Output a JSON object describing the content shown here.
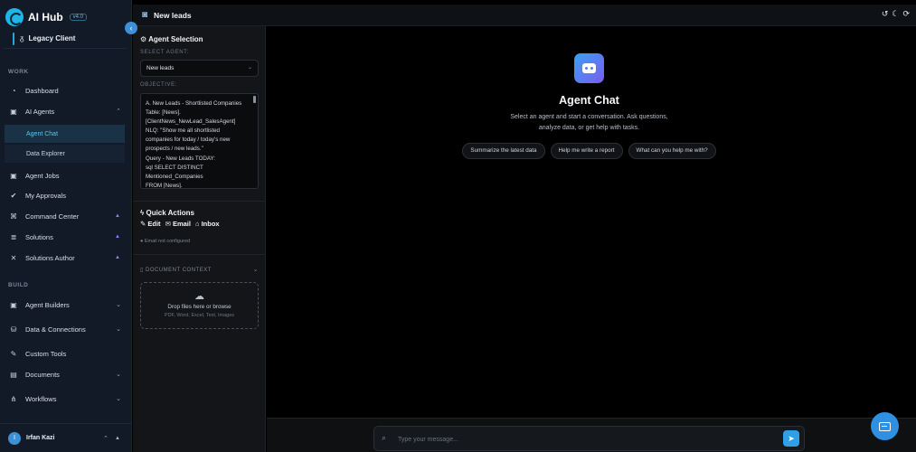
{
  "brand": {
    "title": "AI Hub",
    "version": "v4.0"
  },
  "client": {
    "label": "Legacy Client"
  },
  "sidebar": {
    "work_label": "WORK",
    "build_label": "BUILD",
    "items": [
      {
        "label": "Dashboard",
        "icon": "dashboard-icon"
      },
      {
        "label": "AI Agents",
        "icon": "robot-icon"
      },
      {
        "label": "Agent Chat"
      },
      {
        "label": "Data Explorer"
      },
      {
        "label": "Agent Jobs",
        "icon": "robot-icon"
      },
      {
        "label": "My Approvals",
        "icon": "check-circle-icon"
      },
      {
        "label": "Command Center",
        "icon": "command-icon"
      },
      {
        "label": "Solutions",
        "icon": "layers-icon"
      },
      {
        "label": "Solutions Author",
        "icon": "tools-icon"
      },
      {
        "label": "Agent Builders",
        "icon": "robot-icon"
      },
      {
        "label": "Data & Connections",
        "icon": "database-icon"
      },
      {
        "label": "Custom Tools",
        "icon": "wrench-icon"
      },
      {
        "label": "Documents",
        "icon": "document-icon"
      },
      {
        "label": "Workflows",
        "icon": "workflow-icon"
      }
    ],
    "user": {
      "initial": "I",
      "name": "Irfan Kazi"
    }
  },
  "header": {
    "title": "New leads"
  },
  "panel": {
    "agent_selection_title": "Agent Selection",
    "select_agent_label": "SELECT AGENT:",
    "selected_agent": "New leads",
    "objective_label": "OBJECTIVE:",
    "objective_lines": [
      "A. New Leads - Shortlisted Companies",
      "Table: [News].",
      "[ClientNews_NewLead_SalesAgent]",
      "NLQ: \"Show me all shortlisted",
      "companies for today / today's new",
      "prospects / new leads.\"",
      "Query - New Leads TODAY:",
      "sql SELECT DISTINCT",
      "Mentioned_Companies",
      "FROM [News]."
    ],
    "quick_actions_title": "Quick Actions",
    "quick_edit": "Edit",
    "quick_email": "Email",
    "quick_inbox": "Inbox",
    "email_status": "Email not configured",
    "doc_context_label": "DOCUMENT CONTEXT",
    "dropzone_text": "Drop files here or browse",
    "dropzone_types": "PDF, Word, Excel, Text, Images"
  },
  "chat": {
    "title": "Agent Chat",
    "subtitle_line1": "Select an agent and start a conversation. Ask questions,",
    "subtitle_line2": "analyze data, or get help with tasks.",
    "suggestions": [
      "Summarize the latest data",
      "Help me write a report",
      "What can you help me with?"
    ],
    "input_placeholder": "Type your message..."
  }
}
